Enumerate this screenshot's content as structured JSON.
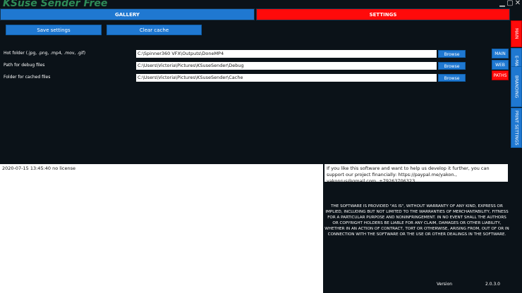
{
  "app": {
    "title": "KSuse Sender Free"
  },
  "window_controls": {
    "minimize": "▁",
    "maximize": "▢",
    "close": "✕"
  },
  "tabs": {
    "gallery": "GALLERY",
    "settings": "SETTINGS"
  },
  "toolbar": {
    "save_settings": "Save settings",
    "clear_cache": "Clear cache"
  },
  "paths": [
    {
      "label": "Hot folder (.jpg, .png, .mp4, .mov, .gif)",
      "value": "C:\\Spinner360 VFX\\Outputs\\DoneMP4",
      "browse": "Browse"
    },
    {
      "label": "Path for debug files",
      "value": "C:\\Users\\Victoria\\Pictures\\KSuseSender\\Debug",
      "browse": "Browse"
    },
    {
      "label": "Folder for cached files",
      "value": "C:\\Users\\Victoria\\Pictures\\KSuseSender\\Cache",
      "browse": "Browse"
    }
  ],
  "subtabs": {
    "main": "MAIN",
    "web": "WEB",
    "paths": "PATHS"
  },
  "side_tabs": {
    "main": "MAIN",
    "email": "E-MAIL",
    "branding": "BRANDING",
    "print_settings": "PRINT SETTINGS"
  },
  "log": {
    "text": "2020-07-15 13:45:40 no license"
  },
  "support": {
    "text": "If you like this software and want to help us develop it further, you can support our project financially: https://paypal.me/yakon., yakonrus@gmail.com, +79263706323"
  },
  "license": {
    "text": "THE SOFTWARE IS PROVIDED \"AS IS\", WITHOUT WARRANTY OF ANY KIND, EXPRESS OR IMPLIED, INCLUDING BUT NOT LIMITED TO THE WARRANTIES OF MERCHANTABILITY, FITNESS FOR A PARTICULAR PURPOSE AND NONINFRINGEMENT. IN NO EVENT SHALL THE AUTHORS OR COPYRIGHT HOLDERS BE LIABLE FOR ANY CLAIM, DAMAGES OR OTHER LIABILITY, WHETHER IN AN ACTION OF CONTRACT, TORT OR OTHERWISE, ARISING FROM, OUT OF OR IN CONNECTION WITH THE SOFTWARE OR THE USE OR OTHER DEALINGS IN THE SOFTWARE."
  },
  "version": {
    "label": "Version",
    "value": "2.0.3.0"
  },
  "colors": {
    "accent_blue": "#1f78d1",
    "active_red": "#ff0a0a",
    "background": "#0b1218",
    "title_green": "#2e8b57"
  }
}
